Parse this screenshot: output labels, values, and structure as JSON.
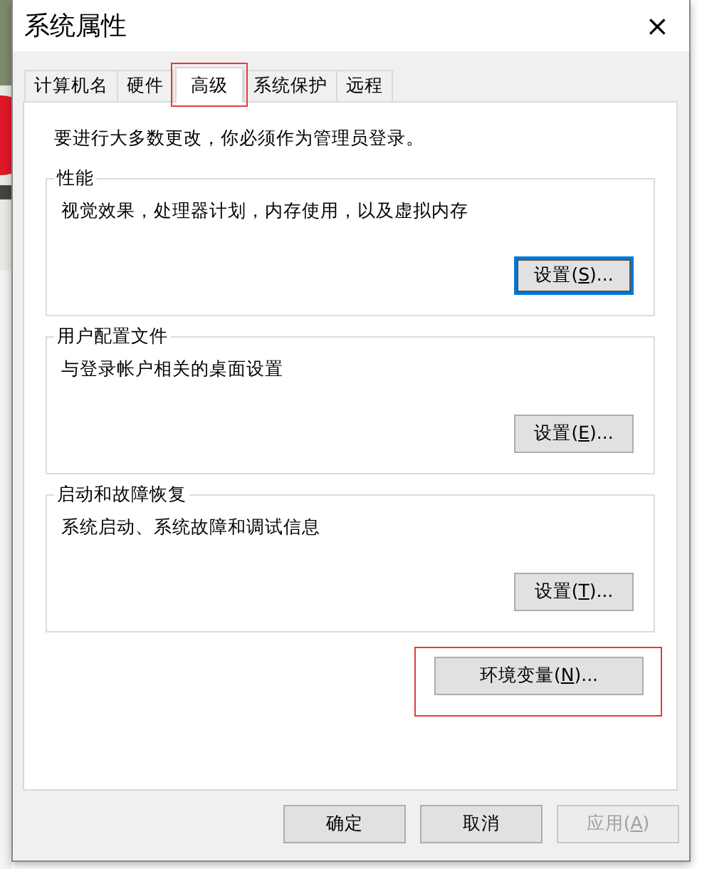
{
  "window": {
    "title": "系统属性",
    "close": "×"
  },
  "tabs": [
    {
      "label": "计算机名",
      "selected": false,
      "highlighted": false
    },
    {
      "label": "硬件",
      "selected": false,
      "highlighted": false
    },
    {
      "label": "高级",
      "selected": true,
      "highlighted": true
    },
    {
      "label": "系统保护",
      "selected": false,
      "highlighted": false
    },
    {
      "label": "远程",
      "selected": false,
      "highlighted": false
    }
  ],
  "notice": "要进行大多数更改，你必须作为管理员登录。",
  "groups": [
    {
      "title": "性能",
      "description": "视觉效果，处理器计划，内存使用，以及虚拟内存",
      "button": {
        "label": [
          "设置(",
          "S",
          ")..."
        ],
        "focused": true
      }
    },
    {
      "title": "用户配置文件",
      "description": "与登录帐户相关的桌面设置",
      "button": {
        "label": [
          "设置(",
          "E",
          ")..."
        ],
        "focused": false
      }
    },
    {
      "title": "启动和故障恢复",
      "description": "系统启动、系统故障和调试信息",
      "button": {
        "label": [
          "设置(",
          "T",
          ")..."
        ],
        "focused": false
      }
    }
  ],
  "env_button": {
    "label": [
      "环境变量(",
      "N",
      ")..."
    ],
    "highlighted": true
  },
  "footer_buttons": [
    {
      "label": [
        "确定"
      ],
      "disabled": false
    },
    {
      "label": [
        "取消"
      ],
      "disabled": false
    },
    {
      "label": [
        "应用(",
        "A",
        ")"
      ],
      "disabled": true
    }
  ]
}
